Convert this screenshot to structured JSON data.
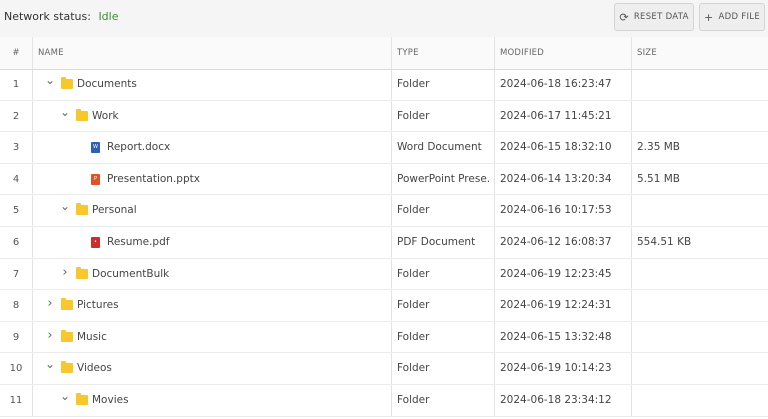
{
  "status": {
    "label": "Network status:",
    "value": "Idle"
  },
  "toolbar": {
    "reset_label": "RESET DATA",
    "add_label": "ADD FILE"
  },
  "columns": {
    "num": "#",
    "name": "NAME",
    "type": "TYPE",
    "modified": "MODIFIED",
    "size": "SIZE"
  },
  "rows": [
    {
      "n": "1",
      "name": "Documents",
      "type": "Folder",
      "modified": "2024-06-18 16:23:47",
      "size": "",
      "level": 0,
      "expand": "open",
      "icon": "folder"
    },
    {
      "n": "2",
      "name": "Work",
      "type": "Folder",
      "modified": "2024-06-17 11:45:21",
      "size": "",
      "level": 1,
      "expand": "open",
      "icon": "folder"
    },
    {
      "n": "3",
      "name": "Report.docx",
      "type": "Word Document",
      "modified": "2024-06-15 18:32:10",
      "size": "2.35 MB",
      "level": 2,
      "expand": "none",
      "icon": "word"
    },
    {
      "n": "4",
      "name": "Presentation.pptx",
      "type": "PowerPoint Prese...",
      "modified": "2024-06-14 13:20:34",
      "size": "5.51 MB",
      "level": 2,
      "expand": "none",
      "icon": "ppt"
    },
    {
      "n": "5",
      "name": "Personal",
      "type": "Folder",
      "modified": "2024-06-16 10:17:53",
      "size": "",
      "level": 1,
      "expand": "open",
      "icon": "folder"
    },
    {
      "n": "6",
      "name": "Resume.pdf",
      "type": "PDF Document",
      "modified": "2024-06-12 16:08:37",
      "size": "554.51 KB",
      "level": 2,
      "expand": "none",
      "icon": "pdf"
    },
    {
      "n": "7",
      "name": "DocumentBulk",
      "type": "Folder",
      "modified": "2024-06-19 12:23:45",
      "size": "",
      "level": 1,
      "expand": "closed",
      "icon": "folder"
    },
    {
      "n": "8",
      "name": "Pictures",
      "type": "Folder",
      "modified": "2024-06-19 12:24:31",
      "size": "",
      "level": 0,
      "expand": "closed",
      "icon": "folder"
    },
    {
      "n": "9",
      "name": "Music",
      "type": "Folder",
      "modified": "2024-06-15 13:32:48",
      "size": "",
      "level": 0,
      "expand": "closed",
      "icon": "folder"
    },
    {
      "n": "10",
      "name": "Videos",
      "type": "Folder",
      "modified": "2024-06-19 10:14:23",
      "size": "",
      "level": 0,
      "expand": "open",
      "icon": "folder"
    },
    {
      "n": "11",
      "name": "Movies",
      "type": "Folder",
      "modified": "2024-06-18 23:34:12",
      "size": "",
      "level": 1,
      "expand": "open",
      "icon": "folder"
    }
  ]
}
